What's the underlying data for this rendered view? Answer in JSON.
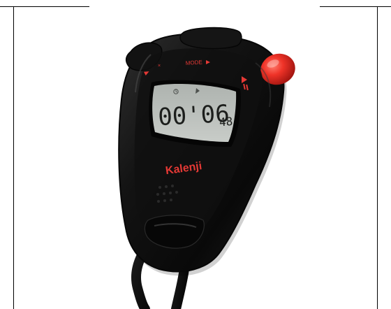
{
  "product": {
    "brand": "Kalenji",
    "display_time": "00'06",
    "display_fraction": "48",
    "mode_label": "MODE",
    "play_pause_icon": "play-pause-icon",
    "reset_icon": "reset-icon"
  },
  "colors": {
    "body": "#111111",
    "body_highlight": "#2b2b2b",
    "lcd": "#b7bcb8",
    "lcd_text": "#1f2220",
    "accent": "#e53935",
    "button": "#e72d25"
  }
}
